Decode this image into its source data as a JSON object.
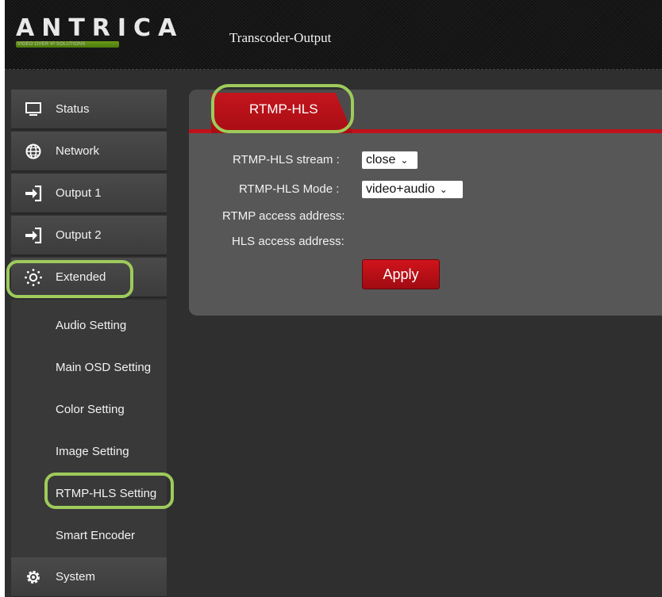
{
  "header": {
    "logo_text": "ANTRICA",
    "logo_subtitle": "VIDEO OVER IP SOLUTIONS",
    "title": "Transcoder-Output"
  },
  "sidebar": {
    "items": [
      {
        "label": "Status",
        "icon": "monitor-icon"
      },
      {
        "label": "Network",
        "icon": "globe-icon"
      },
      {
        "label": "Output 1",
        "icon": "output-arrow-icon"
      },
      {
        "label": "Output 2",
        "icon": "output-arrow-icon"
      },
      {
        "label": "Extended",
        "icon": "sun-gear-icon",
        "highlighted": true
      },
      {
        "label": "System",
        "icon": "gear-icon"
      }
    ],
    "subitems": [
      {
        "label": "Audio Setting"
      },
      {
        "label": "Main OSD Setting"
      },
      {
        "label": "Color Setting"
      },
      {
        "label": "Image Setting"
      },
      {
        "label": "RTMP-HLS Setting",
        "active": true
      },
      {
        "label": "Smart Encoder"
      }
    ]
  },
  "panel": {
    "tab_label": "RTMP-HLS",
    "fields": {
      "stream_label": "RTMP-HLS stream",
      "stream_value": "close",
      "mode_label": "RTMP-HLS Mode",
      "mode_value": "video+audio",
      "rtmp_address_label": "RTMP access address:",
      "hls_address_label": "HLS access address:"
    },
    "apply_label": "Apply"
  },
  "colors": {
    "accent_red": "#c0111a",
    "highlight_green": "#9ecb5b",
    "panel_gray": "#575757",
    "background_dark": "#2f2f2f"
  }
}
